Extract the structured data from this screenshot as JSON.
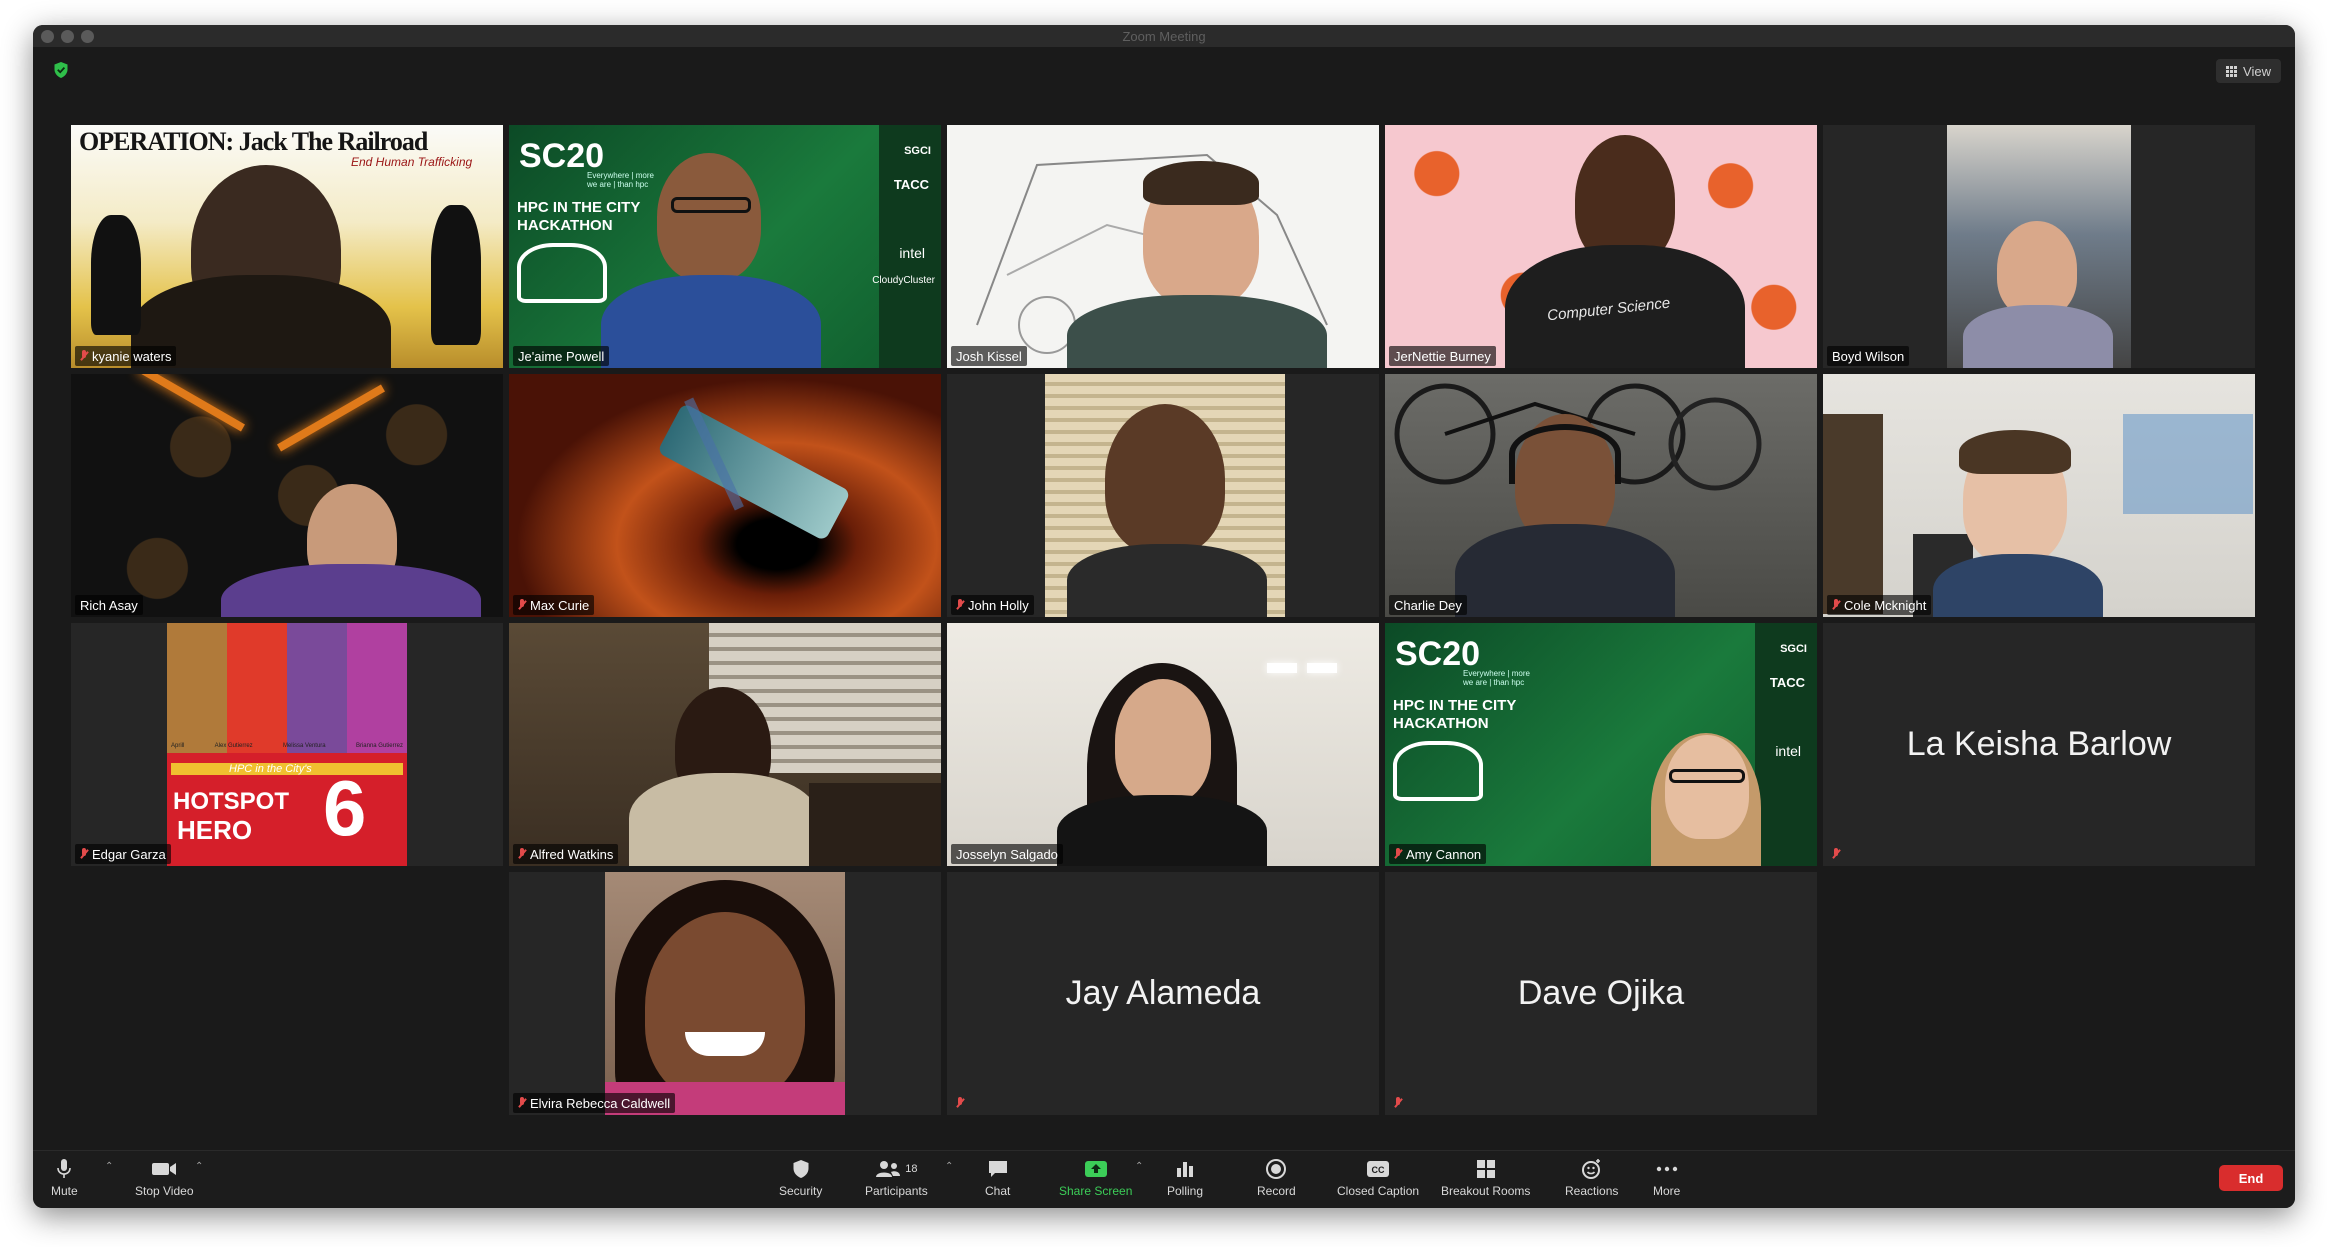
{
  "window": {
    "title": "Zoom Meeting"
  },
  "header": {
    "view_label": "View",
    "security_icon": "shield-check-icon"
  },
  "participants": [
    {
      "name": "kyanie waters",
      "muted": true
    },
    {
      "name": "Je'aime Powell",
      "muted": false
    },
    {
      "name": "Josh Kissel",
      "muted": false
    },
    {
      "name": "JerNettie Burney",
      "muted": false
    },
    {
      "name": "Boyd Wilson",
      "muted": false
    },
    {
      "name": "Rich Asay",
      "muted": false
    },
    {
      "name": "Max Curie",
      "muted": true
    },
    {
      "name": "John Holly",
      "muted": true
    },
    {
      "name": "Charlie Dey",
      "muted": false
    },
    {
      "name": "Cole Mcknight",
      "muted": true
    },
    {
      "name": "Edgar Garza",
      "muted": true
    },
    {
      "name": "Alfred Watkins",
      "muted": true
    },
    {
      "name": "Josselyn Salgado",
      "muted": false,
      "active_speaker": true
    },
    {
      "name": "Amy Cannon",
      "muted": true
    },
    {
      "name": "La Keisha Barlow",
      "muted": true,
      "video_off": true
    },
    {
      "name": "Elvira Rebecca Caldwell",
      "muted": true
    },
    {
      "name": "Jay Alameda",
      "muted": true,
      "video_off": true
    },
    {
      "name": "Dave Ojika",
      "muted": true,
      "video_off": true
    }
  ],
  "backgrounds": {
    "banner_1": "OPERATION: Jack The Railroad",
    "banner_1_sub": "End Human Trafficking",
    "sc20_logo": "SC20",
    "sc20_tagline": "Everywhere | more\nwe are | than hpc",
    "hackathon_line1": "HPC IN THE CITY",
    "hackathon_line2": "HACKATHON",
    "sponsor_1": "SGCI",
    "sponsor_2": "TACC",
    "sponsor_3": "intel",
    "sponsor_4": "CloudyCluster",
    "shirt_text": "Computer Science",
    "hero_line1": "HPC in the City's",
    "hero_line2": "HOTSPOT",
    "hero_line3": "HERO",
    "hero_number": "6",
    "hero_names": [
      "Aprill",
      "Alex Gutierrez",
      "Melissa Ventura",
      "Brianna Gutierrez"
    ]
  },
  "toolbar": {
    "mute": "Mute",
    "stop_video": "Stop Video",
    "security": "Security",
    "participants": "Participants",
    "participants_count": "18",
    "chat": "Chat",
    "share_screen": "Share Screen",
    "polling": "Polling",
    "record": "Record",
    "closed_caption": "Closed Caption",
    "breakout_rooms": "Breakout Rooms",
    "reactions": "Reactions",
    "more": "More",
    "end": "End"
  },
  "colors": {
    "active_speaker": "#e3e58a",
    "share_green": "#3ccd58",
    "end_red": "#d92d2d",
    "muted_red": "#e34b4b"
  }
}
